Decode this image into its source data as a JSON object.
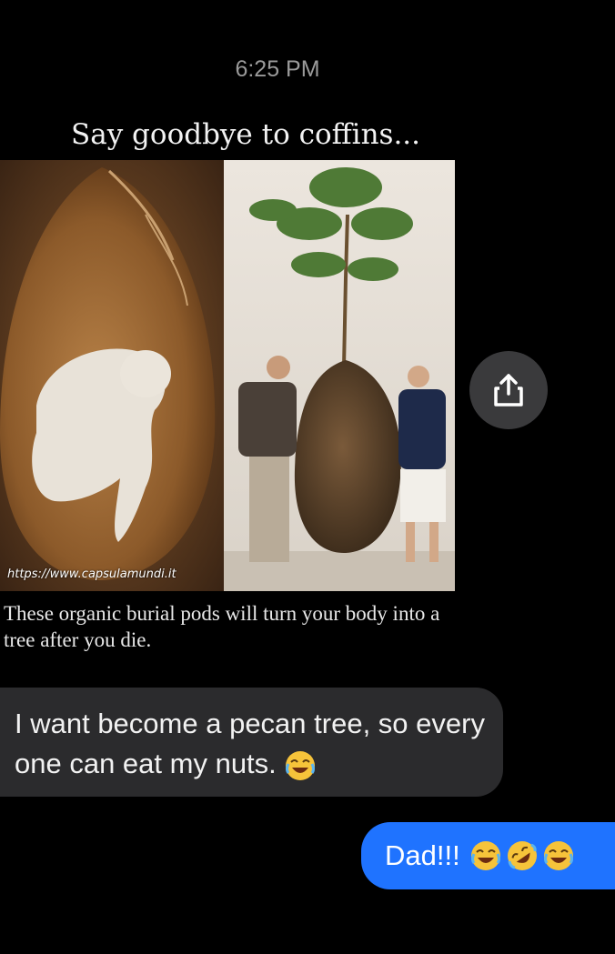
{
  "header": {
    "timestamp": "6:25 PM"
  },
  "shared_post": {
    "title": "Say goodbye to coffins...",
    "watermark_url": "https://www.capsulamundi.it",
    "caption": "These organic burial pods will turn your body into a tree after you die.",
    "share_icon": "share-icon"
  },
  "messages": [
    {
      "direction": "incoming",
      "text": "I want become a pecan tree, so every one can eat my nuts.",
      "emojis": [
        "face-with-tears-of-joy"
      ]
    },
    {
      "direction": "outgoing",
      "text": "Dad!!!",
      "emojis": [
        "face-with-tears-of-joy",
        "rolling-on-the-floor-laughing",
        "face-with-tears-of-joy"
      ]
    }
  ],
  "colors": {
    "background": "#000000",
    "incoming_bubble": "#2b2b2d",
    "outgoing_bubble": "#1f73ff",
    "timestamp": "#9a9a9a"
  }
}
